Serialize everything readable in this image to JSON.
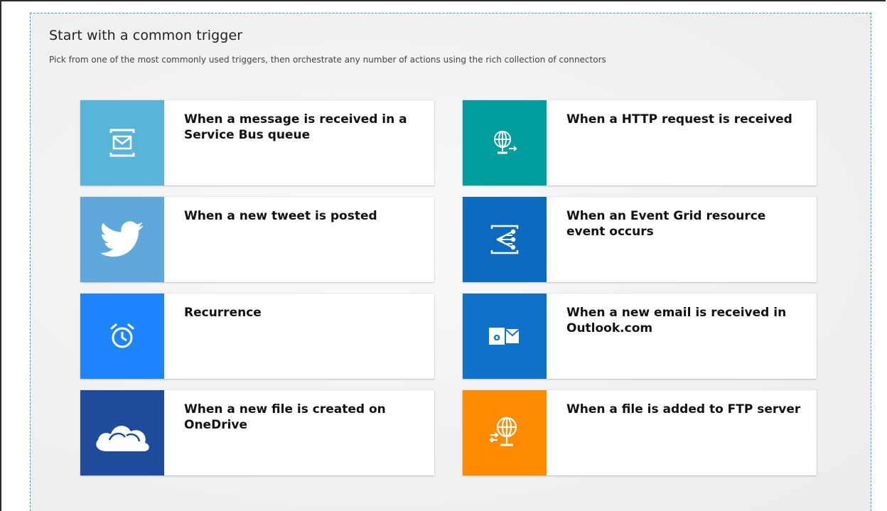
{
  "header": {
    "title": "Start with a common trigger",
    "subtitle": "Pick from one of the most commonly used triggers, then orchestrate any number of actions using the rich collection of connectors"
  },
  "triggers": [
    {
      "label": "When a message is received in a Service Bus queue",
      "icon": "service-bus-icon",
      "color": "#59b4d9"
    },
    {
      "label": "When a HTTP request is received",
      "icon": "http-globe-icon",
      "color": "#009e9e"
    },
    {
      "label": "When a new tweet is posted",
      "icon": "twitter-bird-icon",
      "color": "#5ea8dc"
    },
    {
      "label": "When an Event Grid resource event occurs",
      "icon": "event-grid-icon",
      "color": "#0d6bbf"
    },
    {
      "label": "Recurrence",
      "icon": "alarm-clock-icon",
      "color": "#1f85ff"
    },
    {
      "label": "When a new email is received in Outlook.com",
      "icon": "outlook-icon",
      "color": "#0f72c9"
    },
    {
      "label": "When a new file is created on OneDrive",
      "icon": "onedrive-cloud-icon",
      "color": "#1e4b9b"
    },
    {
      "label": "When a file is added to FTP server",
      "icon": "ftp-globe-icon",
      "color": "#ff8c00"
    }
  ]
}
